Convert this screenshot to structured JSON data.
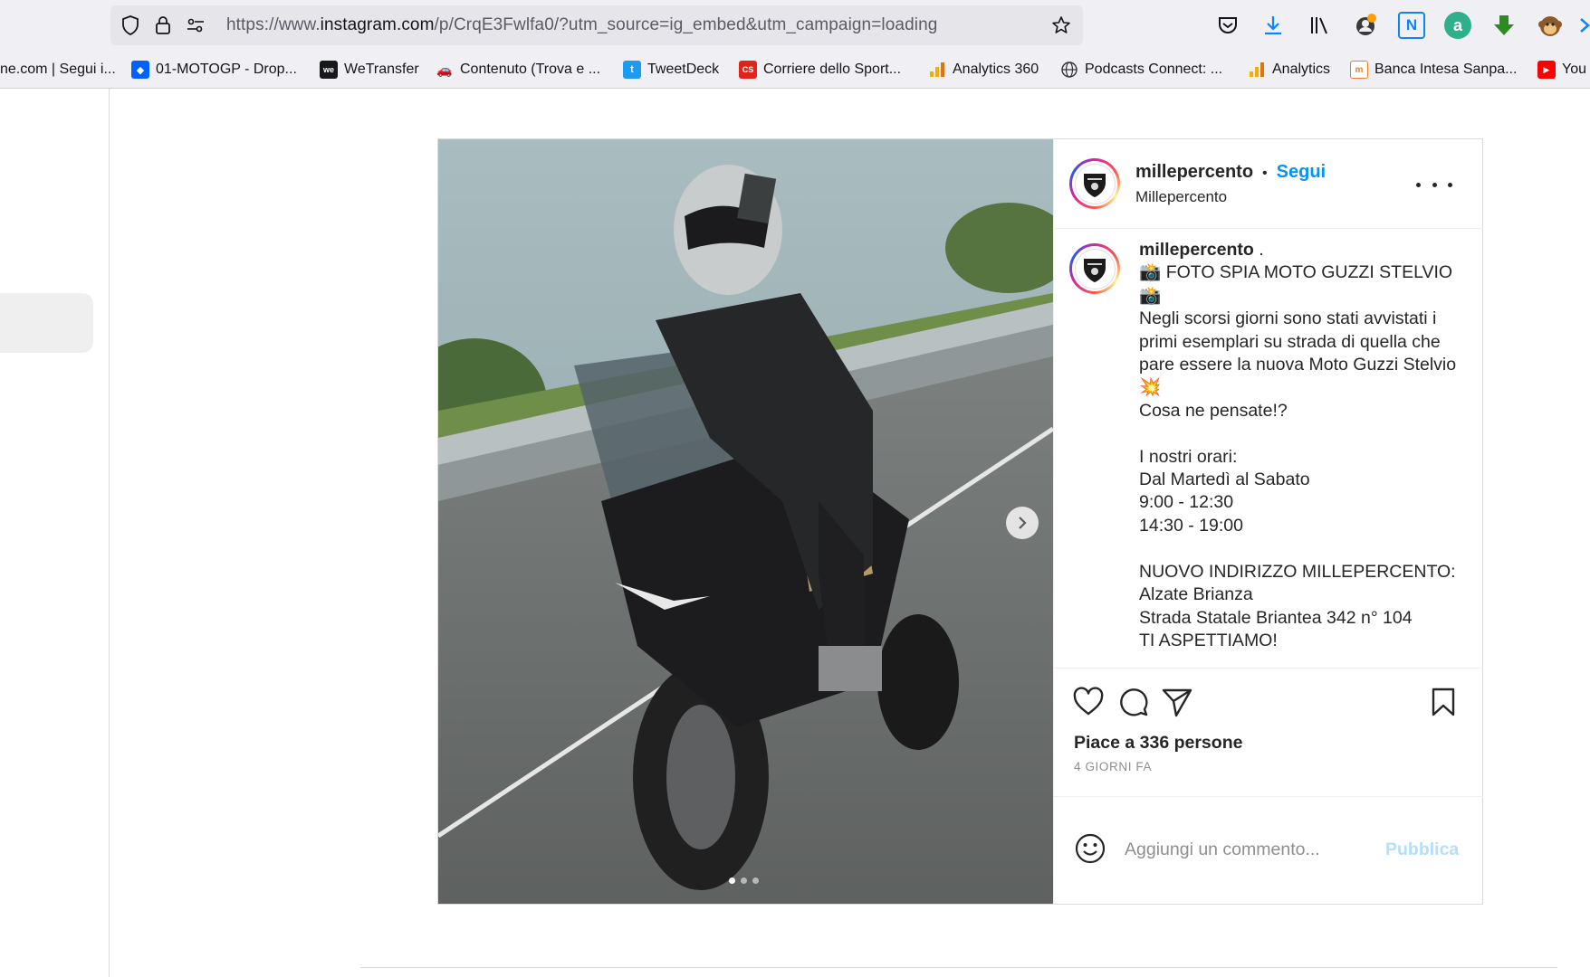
{
  "browser": {
    "url_prefix": "https://www.",
    "url_domain": "instagram.com",
    "url_rest": "/p/CrqE3Fwlfa0/?utm_source=ig_embed&utm_campaign=loading",
    "bookmarks": [
      {
        "label": "ne.com | Segui i...",
        "icon": "generic-icon"
      },
      {
        "label": "01-MOTOGP - Drop...",
        "icon": "dropbox-icon"
      },
      {
        "label": "WeTransfer",
        "icon": "wetransfer-icon"
      },
      {
        "label": "Contenuto (Trova e ...",
        "icon": "car-icon"
      },
      {
        "label": "TweetDeck",
        "icon": "twitter-icon"
      },
      {
        "label": "Corriere dello Sport...",
        "icon": "corriere-icon"
      },
      {
        "label": "Analytics 360",
        "icon": "analytics-icon"
      },
      {
        "label": "Podcasts Connect: ...",
        "icon": "globe-icon"
      },
      {
        "label": "Analytics",
        "icon": "analytics-icon"
      },
      {
        "label": "Banca Intesa Sanpa...",
        "icon": "bank-icon"
      },
      {
        "label": "You",
        "icon": "youtube-icon"
      }
    ]
  },
  "post": {
    "username": "millepercento",
    "separator": "•",
    "follow_label": "Segui",
    "display_name": "Millepercento",
    "caption_user": "millepercento",
    "caption_suffix": " .",
    "caption_text": "📸 FOTO SPIA MOTO GUZZI STELVIO 📸\nNegli scorsi giorni sono stati avvistati i primi esemplari su strada di quella che pare essere la nuova Moto Guzzi Stelvio 💥\nCosa ne pensate!?\n\nI nostri orari:\nDal Martedì al Sabato\n9:00 - 12:30\n14:30 - 19:00\n\nNUOVO INDIRIZZO MILLEPERCENTO:\nAlzate Brianza\nStrada Statale Briantea 342 n° 104\nTI ASPETTIAMO!",
    "likes": "Piace a 336 persone",
    "time_ago": "4 GIORNI FA",
    "comment_placeholder": "Aggiungi un commento...",
    "publish_label": "Pubblica",
    "carousel": {
      "total": 3,
      "active": 1
    }
  },
  "colors": {
    "accent": "#0095f6",
    "publish_disabled": "#b2dffc",
    "text": "#262626",
    "muted": "#8e8e8e"
  }
}
